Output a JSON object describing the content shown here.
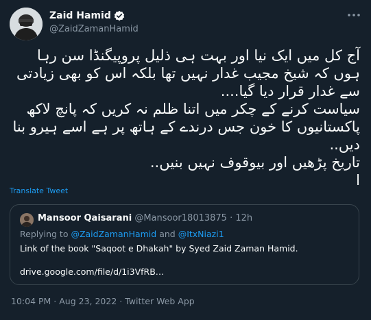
{
  "author": {
    "display_name": "Zaid Hamid",
    "handle": "@ZaidZamanHamid"
  },
  "tweet": {
    "text": "آج کل میں ایک نیا اور بہت ہی ذلیل پروپیگنڈا سن رہا ہوں کہ شیخ مجیب غدار نہیں تھا بلکہ اس کو بھی زیادتی سے غدار قرار دیا گیا....\nسیاست کرنے کے چکر میں اتنا ظلم نہ کریں کہ پانچ لاکھ پاکستانیوں کا خون جس درندے کے ہاتھ پر ہے اسے ہیرو بنا دیں..\nتاریخ پڑھیں اور بیوقوف نہیں بنیں..\nا",
    "translate_label": "Translate Tweet"
  },
  "quote": {
    "name": "Mansoor Qaisarani",
    "handle": "@Mansoor18013875",
    "separator": " · ",
    "time": "12h",
    "replying_prefix": "Replying to ",
    "mention_1": "@ZaidZamanHamid",
    "replying_and": " and ",
    "mention_2": "@ItxNiazi1",
    "text": "Link of the book \"Saqoot e Dhakah\" by Syed Zaid Zaman Hamid.",
    "link": "drive.google.com/file/d/1i3VfRB…"
  },
  "footer": {
    "timestamp": "10:04 PM · Aug 23, 2022 · Twitter Web App"
  },
  "icons": {
    "verified": "verified-badge-icon",
    "more": "more-options-icon"
  },
  "colors": {
    "background": "#15202b",
    "accent": "#1d9bf0",
    "secondary_text": "#8b98a5",
    "border": "#38444d"
  }
}
